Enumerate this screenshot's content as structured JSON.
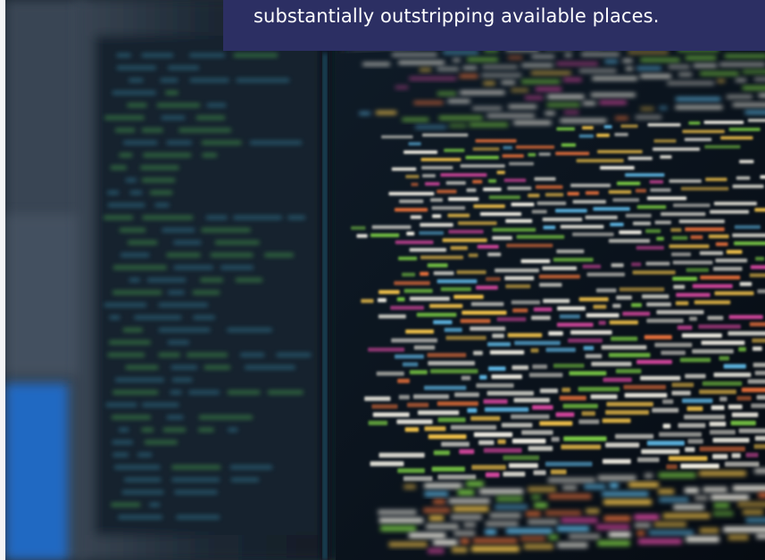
{
  "caption": {
    "text": "substantially outstripping available places."
  },
  "photo": {
    "subject": "blurred-monitor-with-code-icon",
    "accent_colors": [
      "#f4f1e6",
      "#f3c34a",
      "#e8703a",
      "#79c944",
      "#5fb8e6",
      "#d5479e"
    ]
  }
}
